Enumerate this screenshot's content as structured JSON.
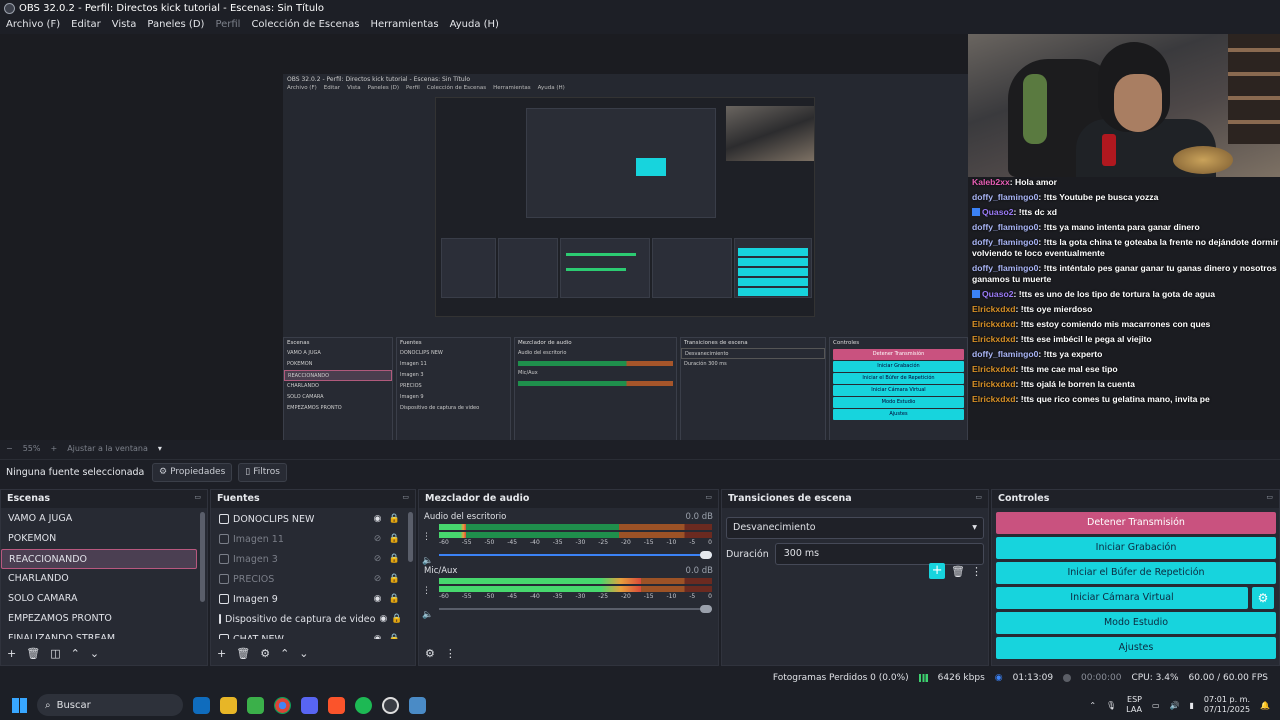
{
  "window": {
    "title": "OBS 32.0.2 - Perfil: Directos kick tutorial - Escenas: Sin Título"
  },
  "menu": [
    "Archivo (F)",
    "Editar",
    "Vista",
    "Paneles (D)",
    "Perfil",
    "Colección de Escenas",
    "Herramientas",
    "Ayuda (H)"
  ],
  "chat": [
    {
      "user": "Kaleb2xx",
      "text": ": Hola amor",
      "color": "pink",
      "badge": false
    },
    {
      "user": "doffy_flamingo0",
      "text": ": !tts Youtube pe busca yozza",
      "color": "blue",
      "badge": false
    },
    {
      "user": "Quaso2",
      "text": ": !tts dc xd",
      "color": "purple",
      "badge": true
    },
    {
      "user": "doffy_flamingo0",
      "text": ": !tts ya mano intenta para ganar dinero",
      "color": "blue",
      "badge": false
    },
    {
      "user": "doffy_flamingo0",
      "text": ": !tts la gota china te goteaba la frente no dejándote dormir volviendo te loco eventualmente",
      "color": "blue",
      "badge": false
    },
    {
      "user": "doffy_flamingo0",
      "text": ": !tts inténtalo pes ganar ganar tu ganas dinero y nosotros ganamos tu muerte",
      "color": "blue",
      "badge": false
    },
    {
      "user": "Quaso2",
      "text": ": !tts es uno de los tipo de tortura la gota de agua",
      "color": "purple",
      "badge": true
    },
    {
      "user": "Elrickxdxd",
      "text": ": !tts oye mierdoso",
      "color": "gold",
      "badge": false
    },
    {
      "user": "Elrickxdxd",
      "text": ": !tts estoy comiendo mis macarrones con ques",
      "color": "gold",
      "badge": false
    },
    {
      "user": "Elrickxdxd",
      "text": ": !tts ese imbécil le pega al viejito",
      "color": "gold",
      "badge": false
    },
    {
      "user": "doffy_flamingo0",
      "text": ": !tts ya experto",
      "color": "blue",
      "badge": false
    },
    {
      "user": "Elrickxdxd",
      "text": ": !tts me cae mal ese tipo",
      "color": "gold",
      "badge": false
    },
    {
      "user": "Elrickxdxd",
      "text": ": !tts ojalá le borren la cuenta",
      "color": "gold",
      "badge": false
    },
    {
      "user": "Elrickxdxd",
      "text": ": !tts que rico comes tu gelatina mano, invita pe",
      "color": "gold",
      "badge": false
    }
  ],
  "zoom": {
    "level": "55%",
    "fit": "Ajustar a la ventana"
  },
  "props": {
    "no_source": "Ninguna fuente seleccionada",
    "properties": "Propiedades",
    "filters": "Filtros"
  },
  "scenes": {
    "title": "Escenas",
    "items": [
      "VAMO A JUGA",
      "POKEMON",
      "REACCIONANDO",
      "CHARLANDO",
      "SOLO CAMARA",
      "EMPEZAMOS PRONTO",
      "FINALIZANDO STREAM"
    ],
    "selected": 2
  },
  "sources": {
    "title": "Fuentes",
    "items": [
      {
        "name": "DONOCLIPS NEW",
        "visible": true
      },
      {
        "name": "Imagen 11",
        "visible": false
      },
      {
        "name": "Imagen 3",
        "visible": false
      },
      {
        "name": "PRECIOS",
        "visible": false
      },
      {
        "name": "Imagen 9",
        "visible": true
      },
      {
        "name": "Dispositivo de captura de video",
        "visible": true
      },
      {
        "name": "CHAT NEW",
        "visible": true
      }
    ]
  },
  "mixer": {
    "title": "Mezclador de audio",
    "channels": [
      {
        "name": "Audio del escritorio",
        "db": "0.0 dB",
        "level": 0.1,
        "volume": 1.0
      },
      {
        "name": "Mic/Aux",
        "db": "0.0 dB",
        "level": 0.74,
        "volume": 1.0
      }
    ],
    "ticks": [
      "-60",
      "-55",
      "-50",
      "-45",
      "-40",
      "-35",
      "-30",
      "-25",
      "-20",
      "-15",
      "-10",
      "-5",
      "0"
    ]
  },
  "transitions": {
    "title": "Transiciones de escena",
    "selected": "Desvanecimiento",
    "duration_label": "Duración",
    "duration": "300 ms"
  },
  "controls": {
    "title": "Controles",
    "stop": "Detener Transmisión",
    "record": "Iniciar Grabación",
    "replay": "Iniciar el Búfer de Repetición",
    "vcam": "Iniciar Cámara Virtual",
    "studio": "Modo Estudio",
    "settings": "Ajustes"
  },
  "status": {
    "dropped": "Fotogramas Perdidos 0 (0.0%)",
    "bitrate": "6426 kbps",
    "stream_time": "01:13:09",
    "rec_time": "00:00:00",
    "cpu": "CPU: 3.4%",
    "fps": "60.00 / 60.00 FPS"
  },
  "taskbar": {
    "search": "Buscar",
    "lang1": "ESP",
    "lang2": "LAA",
    "time": "07:01 p. m.",
    "date": "07/11/2025"
  },
  "colors": {
    "accent": "#17d4dd",
    "stop": "#c9527f",
    "bg": "#1d1f26"
  }
}
